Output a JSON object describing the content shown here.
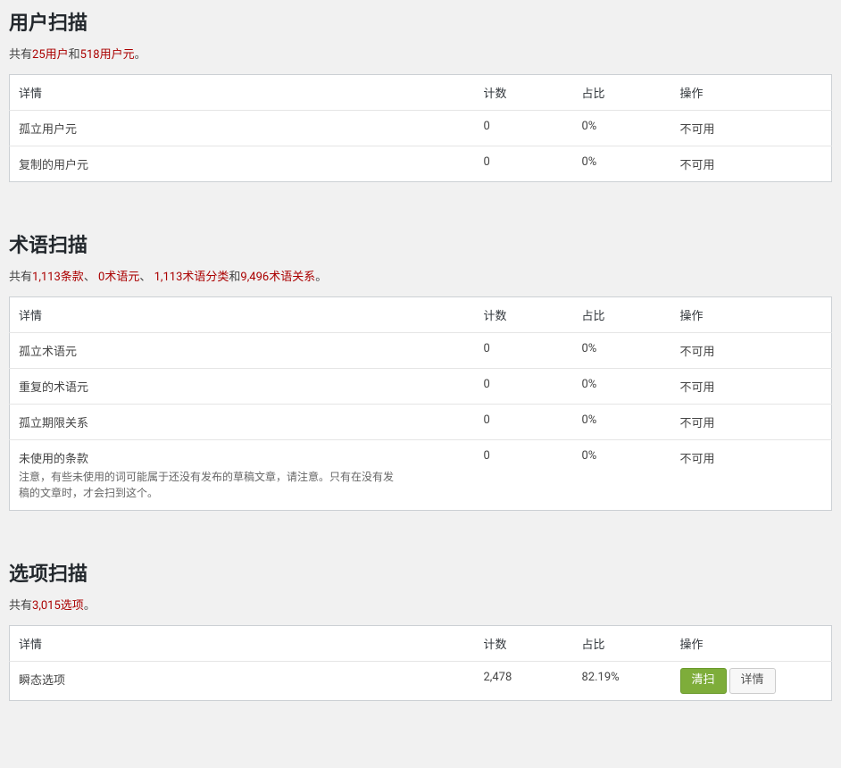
{
  "headers": {
    "detail": "详情",
    "count": "计数",
    "pct": "占比",
    "action": "操作"
  },
  "labels": {
    "unavailable": "不可用",
    "clean_btn": "清扫",
    "detail_btn": "详情"
  },
  "summary_text": {
    "prefix": "共有",
    "and": "和",
    "comma": "、 ",
    "period": "。"
  },
  "sections": [
    {
      "id": "user",
      "title": "用户扫描",
      "summary_parts": [
        {
          "t": "共有",
          "red": false
        },
        {
          "t": "25用户",
          "red": true
        },
        {
          "t": "和",
          "red": false
        },
        {
          "t": "518用户元",
          "red": true
        },
        {
          "t": "。",
          "red": false
        }
      ],
      "rows": [
        {
          "detail": "孤立用户元",
          "note": "",
          "count": "0",
          "pct": "0%",
          "action_type": "unavailable"
        },
        {
          "detail": "复制的用户元",
          "note": "",
          "count": "0",
          "pct": "0%",
          "action_type": "unavailable"
        }
      ]
    },
    {
      "id": "term",
      "title": "术语扫描",
      "summary_parts": [
        {
          "t": "共有",
          "red": false
        },
        {
          "t": "1,113条款",
          "red": true
        },
        {
          "t": "、 ",
          "red": false
        },
        {
          "t": "0术语元",
          "red": true
        },
        {
          "t": "、 ",
          "red": false
        },
        {
          "t": "1,113术语分类",
          "red": true
        },
        {
          "t": "和",
          "red": false
        },
        {
          "t": "9,496术语关系",
          "red": true
        },
        {
          "t": "。",
          "red": false
        }
      ],
      "rows": [
        {
          "detail": "孤立术语元",
          "note": "",
          "count": "0",
          "pct": "0%",
          "action_type": "unavailable"
        },
        {
          "detail": "重复的术语元",
          "note": "",
          "count": "0",
          "pct": "0%",
          "action_type": "unavailable"
        },
        {
          "detail": "孤立期限关系",
          "note": "",
          "count": "0",
          "pct": "0%",
          "action_type": "unavailable"
        },
        {
          "detail": "未使用的条款",
          "note": "注意，有些未使用的词可能属于还没有发布的草稿文章，请注意。只有在没有发稿的文章时，才会扫到这个。",
          "count": "0",
          "pct": "0%",
          "action_type": "unavailable"
        }
      ]
    },
    {
      "id": "option",
      "title": "选项扫描",
      "summary_parts": [
        {
          "t": "共有",
          "red": false
        },
        {
          "t": "3,015选项",
          "red": true
        },
        {
          "t": "。",
          "red": false
        }
      ],
      "rows": [
        {
          "detail": "瞬态选项",
          "note": "",
          "count": "2,478",
          "pct": "82.19%",
          "action_type": "buttons"
        }
      ]
    }
  ]
}
